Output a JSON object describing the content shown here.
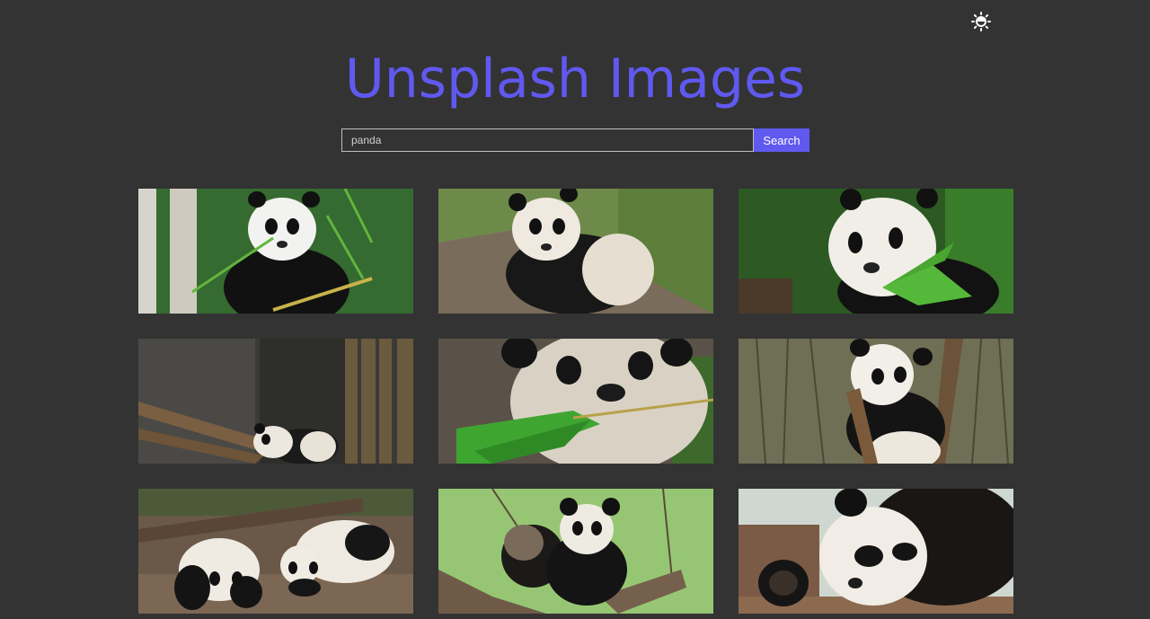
{
  "header": {
    "title": "Unsplash Images",
    "theme_icon": "sun-icon"
  },
  "search": {
    "value": "panda",
    "button_label": "Search"
  },
  "results": [
    {
      "alt": "panda eating bamboo among green leaves"
    },
    {
      "alt": "panda sitting on wooden platform"
    },
    {
      "alt": "panda chewing bamboo leaves"
    },
    {
      "alt": "panda cub climbing on logs"
    },
    {
      "alt": "close-up panda eating bamboo"
    },
    {
      "alt": "panda cub hugging tree trunk"
    },
    {
      "alt": "two panda cubs lying on wood"
    },
    {
      "alt": "panda cubs on tree branch"
    },
    {
      "alt": "panda lying on its side"
    }
  ],
  "colors": {
    "background": "#333333",
    "accent": "#6059f0"
  }
}
